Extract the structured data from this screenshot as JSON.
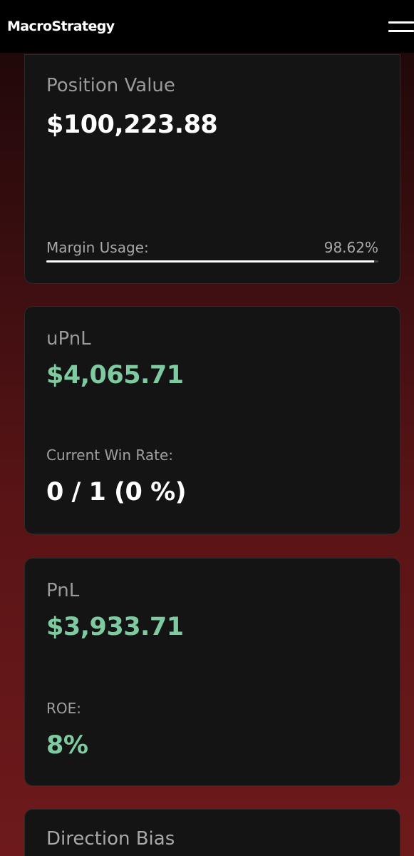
{
  "header": {
    "brand": "MacroStrategy",
    "menu_icon": "hamburger-menu-icon"
  },
  "position_card": {
    "label": "Position Value",
    "value": "$100,223.88",
    "margin_label": "Margin Usage:",
    "margin_value": "98.62%",
    "margin_fraction": 0.9862
  },
  "upnl_card": {
    "label": "uPnL",
    "value": "$4,065.71",
    "win_rate_label": "Current Win Rate:",
    "win_rate_value": "0 / 1 (0 %)"
  },
  "pnl_card": {
    "label": "PnL",
    "value": "$3,933.71",
    "roe_label": "ROE:",
    "roe_value": "8%"
  },
  "bias_card": {
    "label": "Direction Bias"
  },
  "colors": {
    "positive": "#7ecba1",
    "card_bg": "#141414",
    "header_bg": "#000000"
  }
}
